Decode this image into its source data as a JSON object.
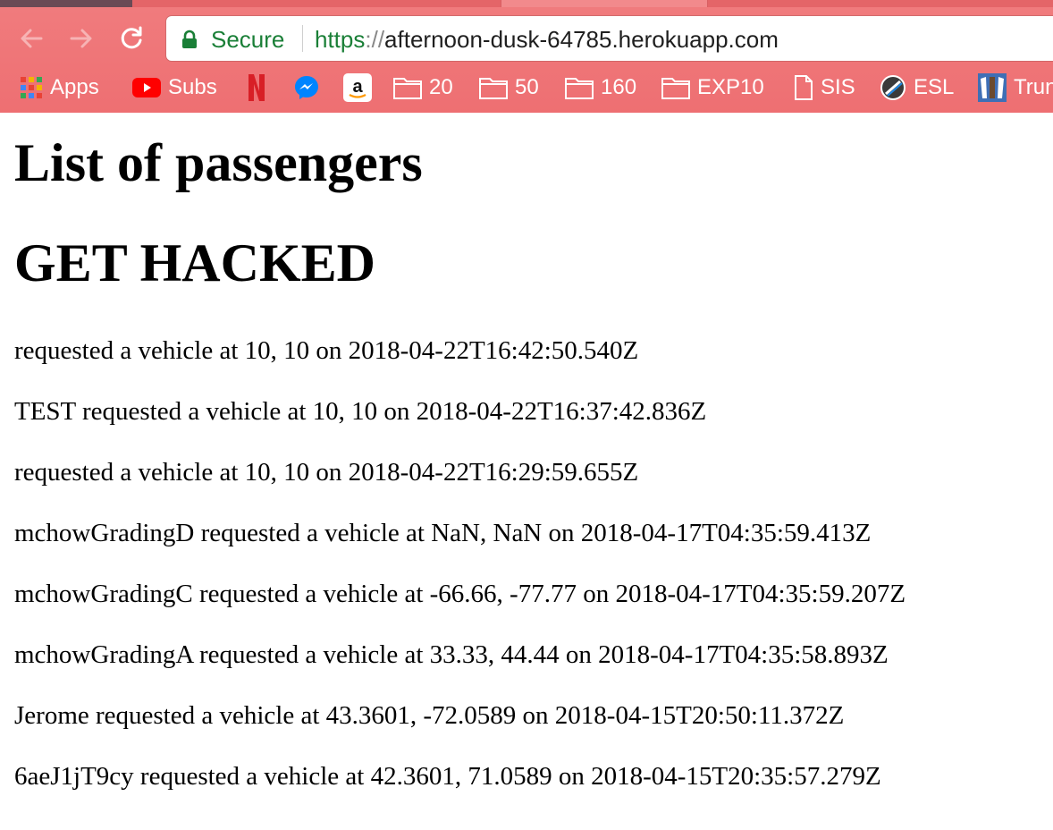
{
  "browser": {
    "security_label": "Secure",
    "url": {
      "scheme": "https",
      "separator": "://",
      "host": "afternoon-dusk-64785.herokuapp.com"
    },
    "bookmarks": [
      {
        "label": "Apps",
        "icon": "apps-grid-icon"
      },
      {
        "label": "Subs",
        "icon": "youtube-icon"
      },
      {
        "label": "",
        "icon": "netflix-icon"
      },
      {
        "label": "",
        "icon": "messenger-icon"
      },
      {
        "label": "",
        "icon": "amazon-icon"
      },
      {
        "label": "20",
        "icon": "folder-icon"
      },
      {
        "label": "50",
        "icon": "folder-icon"
      },
      {
        "label": "160",
        "icon": "folder-icon"
      },
      {
        "label": "EXP10",
        "icon": "folder-icon"
      },
      {
        "label": "SIS",
        "icon": "document-icon"
      },
      {
        "label": "ESL",
        "icon": "esl-logo-icon"
      },
      {
        "label": "Trun",
        "icon": "tufts-logo-icon"
      }
    ],
    "colors": {
      "chrome": "#ee6f72",
      "secure_green": "#1a7f37"
    }
  },
  "page": {
    "title": "List of passengers",
    "banner": "GET HACKED",
    "entries": [
      "requested a vehicle at 10, 10 on 2018-04-22T16:42:50.540Z",
      "TEST requested a vehicle at 10, 10 on 2018-04-22T16:37:42.836Z",
      "requested a vehicle at 10, 10 on 2018-04-22T16:29:59.655Z",
      "mchowGradingD requested a vehicle at NaN, NaN on 2018-04-17T04:35:59.413Z",
      "mchowGradingC requested a vehicle at -66.66, -77.77 on 2018-04-17T04:35:59.207Z",
      "mchowGradingA requested a vehicle at 33.33, 44.44 on 2018-04-17T04:35:58.893Z",
      "Jerome requested a vehicle at 43.3601, -72.0589 on 2018-04-15T20:50:11.372Z",
      "6aeJ1jT9cy requested a vehicle at 42.3601, 71.0589 on 2018-04-15T20:35:57.279Z"
    ]
  }
}
